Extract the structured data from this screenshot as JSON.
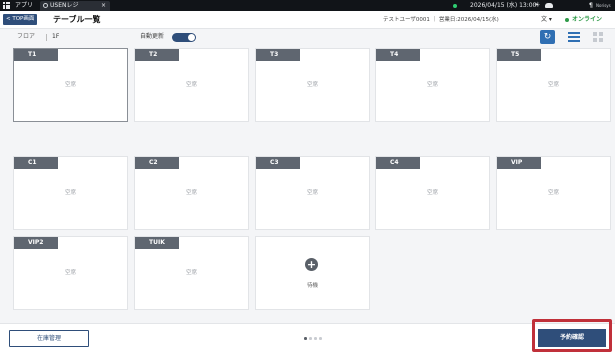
{
  "sysbar": {
    "apps_label": "アプリ",
    "tab_title": "USENレジ",
    "tab_close": "×",
    "datetime": "2026/04/15 (水) 13:00",
    "sun_icon": "☀",
    "brand_icon": "¶",
    "brand_text": "Norisys"
  },
  "header": {
    "back_label": "< TOP画面",
    "title": "テーブル一覧",
    "user_info": "テストユーザ0001 ｜ 営業日:2026/04/15(水)",
    "lang": "文 ▾",
    "online_label": "オンライン",
    "online_color": "#2e9a48"
  },
  "floorbar": {
    "floor_label": "フロア",
    "floor_value": "1F",
    "auto_label": "自動更新",
    "auto_update": true,
    "refresh_icon": "↻"
  },
  "tables": [
    {
      "label": "T1",
      "state": "空席"
    },
    {
      "label": "T2",
      "state": "空席"
    },
    {
      "label": "T3",
      "state": "空席"
    },
    {
      "label": "T4",
      "state": "空席"
    },
    {
      "label": "T5",
      "state": "空席"
    },
    {
      "label": "C1",
      "state": "空席"
    },
    {
      "label": "C2",
      "state": "空席"
    },
    {
      "label": "C3",
      "state": "空席"
    },
    {
      "label": "C4",
      "state": "空席"
    },
    {
      "label": "VIP",
      "state": "空席"
    },
    {
      "label": "VIP2",
      "state": "空席"
    },
    {
      "label": "TUIK",
      "state": "空席"
    }
  ],
  "add_card": {
    "icon": "+",
    "label": "待機"
  },
  "footer": {
    "stock_label": "在庫管理",
    "reserve_label": "予約確認",
    "page_index": 1,
    "page_count": 4,
    "highlight_color": "#c0303a",
    "accent_color": "#2f4e7a"
  }
}
